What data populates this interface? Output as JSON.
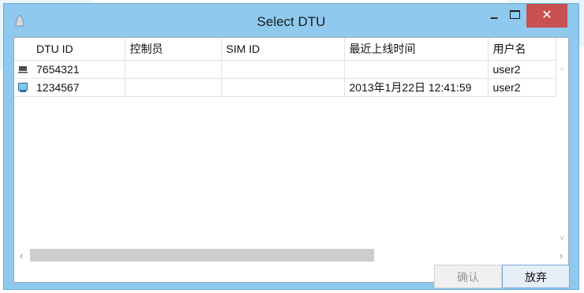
{
  "window": {
    "title": "Select DTU",
    "controls": {
      "minimize": "–",
      "maximize": "□",
      "close": "✕"
    }
  },
  "table": {
    "columns": [
      "DTU ID",
      "控制员",
      "SIM ID",
      "最近上线时间",
      "用户名"
    ],
    "rows": [
      {
        "icon": "dtu-offline-icon",
        "dtu_id": "7654321",
        "controller": "",
        "sim_id": "",
        "last_online": "",
        "username": "user2"
      },
      {
        "icon": "dtu-online-icon",
        "dtu_id": "1234567",
        "controller": "",
        "sim_id": "",
        "last_online": "2013年1月22日 12:41:59",
        "username": "user2"
      }
    ]
  },
  "scrollbars": {
    "left_arrow": "‹",
    "right_arrow": "›",
    "up_arrow": "^",
    "down_arrow": "v"
  },
  "buttons": {
    "confirm": "确认",
    "cancel": "放弃"
  },
  "colors": {
    "frame": "#8fc9ee",
    "close": "#c75050",
    "accent_border": "#7aa7d8"
  }
}
